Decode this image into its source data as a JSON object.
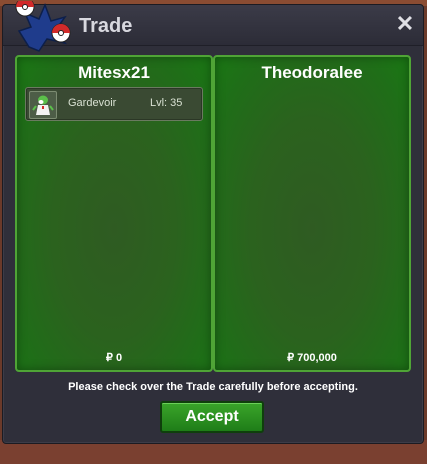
{
  "window": {
    "title": "Trade",
    "close_label": "✕"
  },
  "left_panel": {
    "trainer": "Mitesx21",
    "pokemon": [
      {
        "name": "Gardevoir",
        "level": "Lvl: 35"
      }
    ],
    "money": "₽ 0"
  },
  "right_panel": {
    "trainer": "Theodoralee",
    "pokemon": [],
    "money": "₽ 700,000"
  },
  "notice": "Please check over the Trade carefully before accepting.",
  "accept_label": "Accept",
  "colors": {
    "accent_green": "#1f7d18",
    "panel_border": "#4fa436",
    "window_bg": "#2f2f3a"
  }
}
